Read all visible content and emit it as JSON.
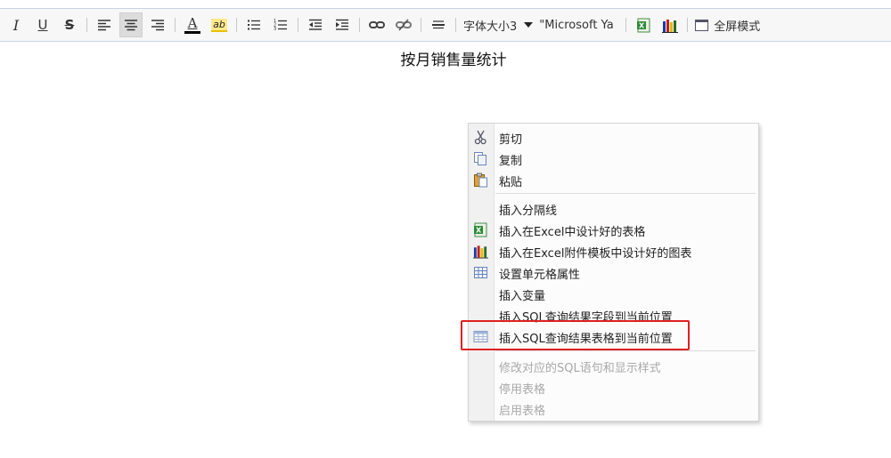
{
  "toolbar": {
    "italic": "I",
    "underline": "U",
    "strike": "S",
    "text_color_glyph": "A",
    "highlight_glyph": "ab",
    "font_size_label": "字体大小3",
    "font_name_value": "\"Microsoft Ya",
    "fullscreen_label": "全屏模式"
  },
  "document": {
    "title": "按月销售量统计"
  },
  "context_menu": {
    "items": [
      {
        "label": "剪切",
        "icon": "scissors-icon",
        "enabled": true
      },
      {
        "label": "复制",
        "icon": "copy-icon",
        "enabled": true
      },
      {
        "label": "粘贴",
        "icon": "paste-icon",
        "enabled": true
      },
      {
        "label": "插入分隔线",
        "icon": "",
        "enabled": true
      },
      {
        "label": "插入在Excel中设计好的表格",
        "icon": "excel-icon",
        "enabled": true
      },
      {
        "label": "插入在Excel附件模板中设计好的图表",
        "icon": "bar-chart-icon",
        "enabled": true
      },
      {
        "label": "设置单元格属性",
        "icon": "table-grid-icon",
        "enabled": true
      },
      {
        "label": "插入变量",
        "icon": "",
        "enabled": true
      },
      {
        "label": "插入SQL查询结果字段到当前位置",
        "icon": "",
        "enabled": true
      },
      {
        "label": "插入SQL查询结果表格到当前位置",
        "icon": "sql-table-icon",
        "enabled": true
      },
      {
        "label": "修改对应的SQL语句和显示样式",
        "icon": "",
        "enabled": false
      },
      {
        "label": "停用表格",
        "icon": "",
        "enabled": false
      },
      {
        "label": "启用表格",
        "icon": "",
        "enabled": false
      }
    ]
  },
  "colors": {
    "highlight_border": "#e02020",
    "toolbar_bg": "#f7f7f7",
    "disabled_text": "#a8a8a8"
  }
}
